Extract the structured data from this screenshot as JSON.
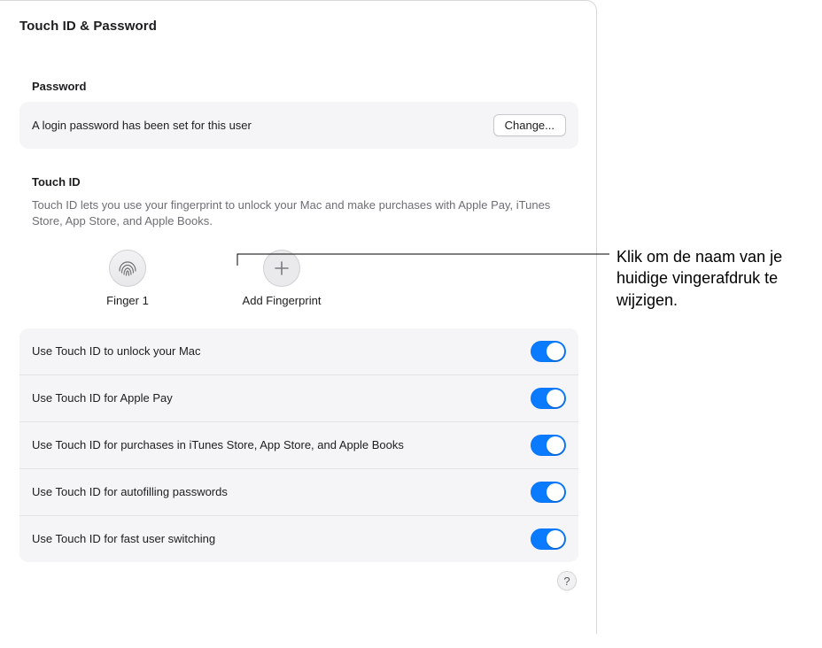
{
  "page": {
    "title": "Touch ID & Password"
  },
  "password": {
    "heading": "Password",
    "status": "A login password has been set for this user",
    "change_label": "Change..."
  },
  "touchid": {
    "heading": "Touch ID",
    "description": "Touch ID lets you use your fingerprint to unlock your Mac and make purchases with Apple Pay, iTunes Store, App Store, and Apple Books.",
    "fingers": [
      {
        "label": "Finger 1"
      }
    ],
    "add_label": "Add Fingerprint"
  },
  "options": [
    {
      "label": "Use Touch ID to unlock your Mac",
      "on": true
    },
    {
      "label": "Use Touch ID for Apple Pay",
      "on": true
    },
    {
      "label": "Use Touch ID for purchases in iTunes Store, App Store, and Apple Books",
      "on": true
    },
    {
      "label": "Use Touch ID for autofilling passwords",
      "on": true
    },
    {
      "label": "Use Touch ID for fast user switching",
      "on": true
    }
  ],
  "help": {
    "glyph": "?"
  },
  "callout": {
    "text": "Klik om de naam van je huidige vingerafdruk te wijzigen."
  }
}
